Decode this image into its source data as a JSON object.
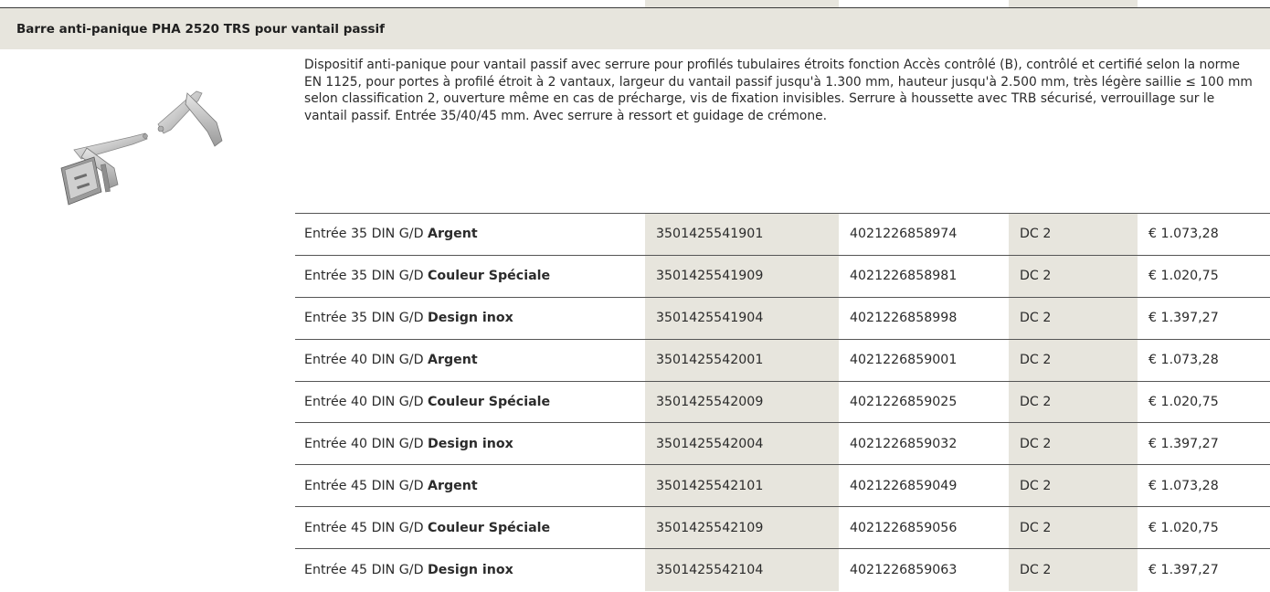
{
  "section": {
    "title": "Barre anti-panique PHA 2520 TRS pour vantail passif"
  },
  "product": {
    "image_icon": "panic-bar-product-photo",
    "description": "Dispositif anti-panique pour vantail passif avec serrure pour profilés tubulaires étroits fonction Accès contrôlé (B), contrôlé et certifié selon la norme EN 1125, pour portes à profilé étroit à 2 vantaux, largeur du vantail passif jusqu'à 1.300 mm, hauteur jusqu'à 2.500 mm, très légère saillie ≤ 100 mm selon classification 2, ouverture même en cas de précharge, vis de fixation invisibles. Serrure à houssette avec TRB sécurisé, verrouillage sur le vantail passif. Entrée 35/40/45 mm. Avec serrure à ressort et guidage de crémone."
  },
  "colors": {
    "shade": "#e7e5dd",
    "rule": "#555555",
    "text": "#2b2b2b"
  },
  "table": {
    "rows": [
      {
        "desc_prefix": "Entrée 35 DIN G/D",
        "desc_finish": "Argent",
        "article_no": "3501425541901",
        "ean": "4021226858974",
        "class": "DC 2",
        "price": "€ 1.073,28"
      },
      {
        "desc_prefix": "Entrée 35 DIN G/D",
        "desc_finish": "Couleur Spéciale",
        "article_no": "3501425541909",
        "ean": "4021226858981",
        "class": "DC 2",
        "price": "€ 1.020,75"
      },
      {
        "desc_prefix": "Entrée 35 DIN G/D",
        "desc_finish": "Design inox",
        "article_no": "3501425541904",
        "ean": "4021226858998",
        "class": "DC 2",
        "price": "€ 1.397,27"
      },
      {
        "desc_prefix": "Entrée 40 DIN G/D",
        "desc_finish": "Argent",
        "article_no": "3501425542001",
        "ean": "4021226859001",
        "class": "DC 2",
        "price": "€ 1.073,28"
      },
      {
        "desc_prefix": "Entrée 40 DIN G/D",
        "desc_finish": "Couleur Spéciale",
        "article_no": "3501425542009",
        "ean": "4021226859025",
        "class": "DC 2",
        "price": "€ 1.020,75"
      },
      {
        "desc_prefix": "Entrée 40 DIN G/D",
        "desc_finish": "Design inox",
        "article_no": "3501425542004",
        "ean": "4021226859032",
        "class": "DC 2",
        "price": "€ 1.397,27"
      },
      {
        "desc_prefix": "Entrée 45 DIN G/D",
        "desc_finish": "Argent",
        "article_no": "3501425542101",
        "ean": "4021226859049",
        "class": "DC 2",
        "price": "€ 1.073,28"
      },
      {
        "desc_prefix": "Entrée 45 DIN G/D",
        "desc_finish": "Couleur Spéciale",
        "article_no": "3501425542109",
        "ean": "4021226859056",
        "class": "DC 2",
        "price": "€ 1.020,75"
      },
      {
        "desc_prefix": "Entrée 45 DIN G/D",
        "desc_finish": "Design inox",
        "article_no": "3501425542104",
        "ean": "4021226859063",
        "class": "DC 2",
        "price": "€ 1.397,27"
      }
    ]
  }
}
